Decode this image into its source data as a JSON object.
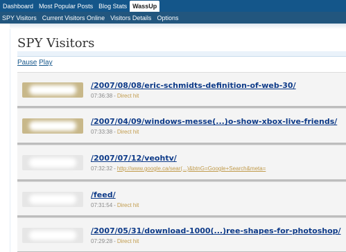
{
  "topnav": {
    "items": [
      {
        "label": "Dashboard"
      },
      {
        "label": "Most Popular Posts"
      },
      {
        "label": "Blog Stats"
      },
      {
        "label": "WassUp",
        "active": true
      }
    ]
  },
  "subnav": {
    "items": [
      {
        "label": "SPY Visitors"
      },
      {
        "label": "Current Visitors Online"
      },
      {
        "label": "Visitors Details"
      },
      {
        "label": "Options"
      }
    ]
  },
  "page": {
    "title": "SPY Visitors",
    "pause_label": "Pause",
    "play_label": "Play"
  },
  "visitors": [
    {
      "url": "/2007/08/08/eric-schmidts-definition-of-web-30/",
      "time": "07:36:38",
      "referrer": "Direct hit",
      "referrer_is_link": false,
      "avatar_color": "#c8b88a"
    },
    {
      "url": "/2007/04/09/windows-messe(...)o-show-xbox-live-friends/",
      "time": "07:33:38",
      "referrer": "Direct hit",
      "referrer_is_link": false,
      "avatar_color": "#c8b88a"
    },
    {
      "url": "/2007/07/12/veohtv/",
      "time": "07:32:32",
      "referrer": "http://www.google.ca/sear(...)&btnG=Google+Search&meta=",
      "referrer_is_link": true,
      "avatar_color": "#e6e6e6"
    },
    {
      "url": "/feed/",
      "time": "07:31:54",
      "referrer": "Direct hit",
      "referrer_is_link": false,
      "avatar_color": "#e6e6e6"
    },
    {
      "url": "/2007/05/31/download-1000(...)ree-shapes-for-photoshop/",
      "time": "07:29:28",
      "referrer": "Direct hit",
      "referrer_is_link": false,
      "avatar_color": "#e6e6e6"
    }
  ],
  "meta": {
    "dash": "-"
  }
}
